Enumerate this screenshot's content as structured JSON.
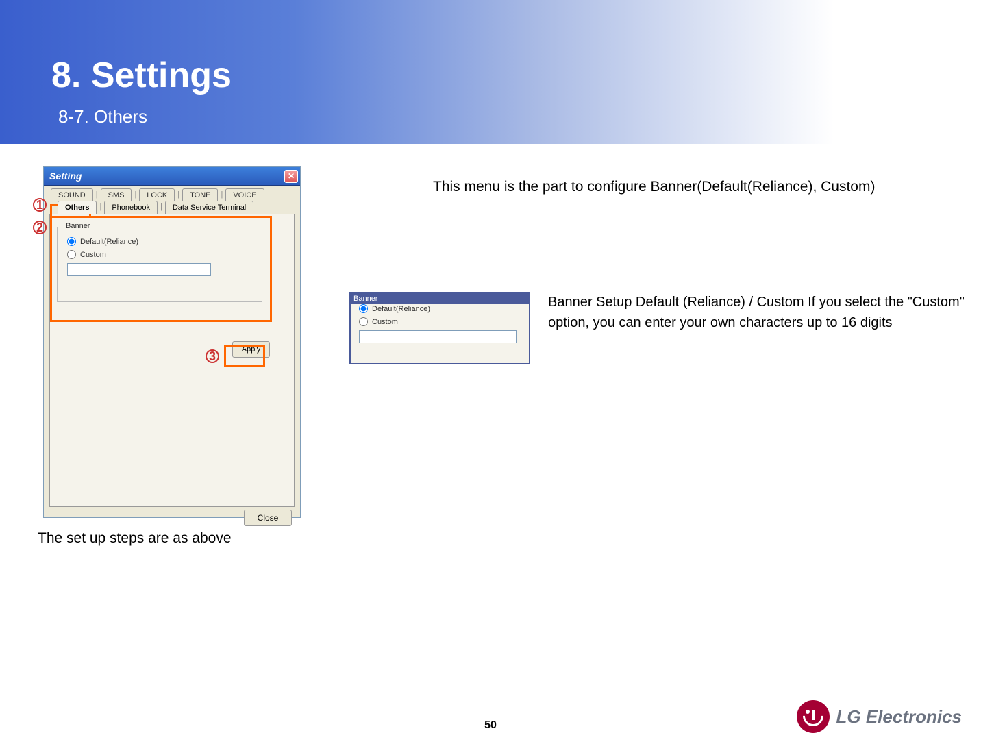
{
  "page": {
    "title": "8. Settings",
    "subtitle": "8-7. Others",
    "caption": "The set up steps are as above",
    "page_number": "50"
  },
  "window": {
    "title": "Setting",
    "tabs_row1": {
      "sound": "SOUND",
      "sms": "SMS",
      "lock": "LOCK",
      "tone": "TONE",
      "voice": "VOICE"
    },
    "tabs_row2": {
      "others": "Others",
      "phonebook": "Phonebook",
      "dst": "Data Service Terminal"
    },
    "banner": {
      "group_label": "Banner",
      "default_label": "Default(Reliance)",
      "custom_label": "Custom",
      "custom_value": ""
    },
    "apply_label": "Apply",
    "close_label": "Close"
  },
  "markers": {
    "one": "1",
    "two": "2",
    "three": "3"
  },
  "descriptions": {
    "main": "This menu is the part to configure Banner(Default(Reliance), Custom)",
    "detail": "Banner Setup Default (Reliance) / Custom If you select the \"Custom\" option, you can enter your own characters up to 16 digits"
  },
  "zoom": {
    "title": "Banner",
    "default_label": "Default(Reliance)",
    "custom_label": "Custom"
  },
  "logo": {
    "text": "LG Electronics"
  }
}
